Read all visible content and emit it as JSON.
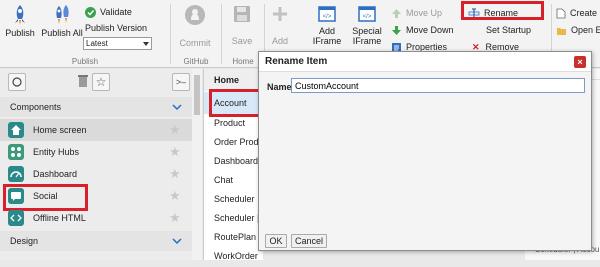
{
  "ribbon": {
    "publish": {
      "label": "Publish"
    },
    "publish_all": {
      "label": "Publish All"
    },
    "validate": {
      "label": "Validate"
    },
    "publish_version": {
      "label": "Publish Version",
      "selected": "Latest"
    },
    "group_publish": "Publish",
    "commit": {
      "label": "Commit"
    },
    "group_github": "GitHub",
    "save": {
      "label": "Save"
    },
    "group_home": "Home",
    "add": {
      "label": "Add"
    },
    "add_iframe": {
      "label": "Add IFrame",
      "line1": "Add",
      "line2": "IFrame"
    },
    "special_iframe": {
      "line1": "Special",
      "line2": "IFrame"
    },
    "move_up": "Move Up",
    "move_down": "Move Down",
    "properties": "Properties",
    "rename": "Rename",
    "set_startup": "Set Startup",
    "remove": "Remove",
    "create_new": "Create N",
    "open_existing": "Open Ex"
  },
  "left_panel": {
    "components_header": "Components",
    "items": [
      {
        "label": "Home screen",
        "icon": "home-icon"
      },
      {
        "label": "Entity Hubs",
        "icon": "entity-hubs-icon"
      },
      {
        "label": "Dashboard",
        "icon": "dashboard-icon"
      },
      {
        "label": "Social",
        "icon": "social-icon"
      },
      {
        "label": "Offline HTML",
        "icon": "html-icon"
      }
    ],
    "design_header": "Design"
  },
  "mid_list": {
    "header": "Home",
    "items": [
      "Account",
      "Product",
      "Order Produc",
      "Dashboard",
      "Chat",
      "Scheduler",
      "Scheduler | W",
      "RoutePlan | V",
      "WorkOrder"
    ]
  },
  "right_strip": {
    "bottom_text": "Scheduler | Accou"
  },
  "dialog": {
    "title": "Rename Item",
    "close_glyph": "×",
    "name_label": "Name",
    "name_value": "CustomAccount",
    "ok_label": "OK",
    "cancel_label": "Cancel"
  },
  "colors": {
    "highlight_red": "#d6202a",
    "selected_blue": "#1f6fc4",
    "home_icon_teal": "#2a8a8a",
    "ribbon_bg": "#f3f3f3"
  }
}
